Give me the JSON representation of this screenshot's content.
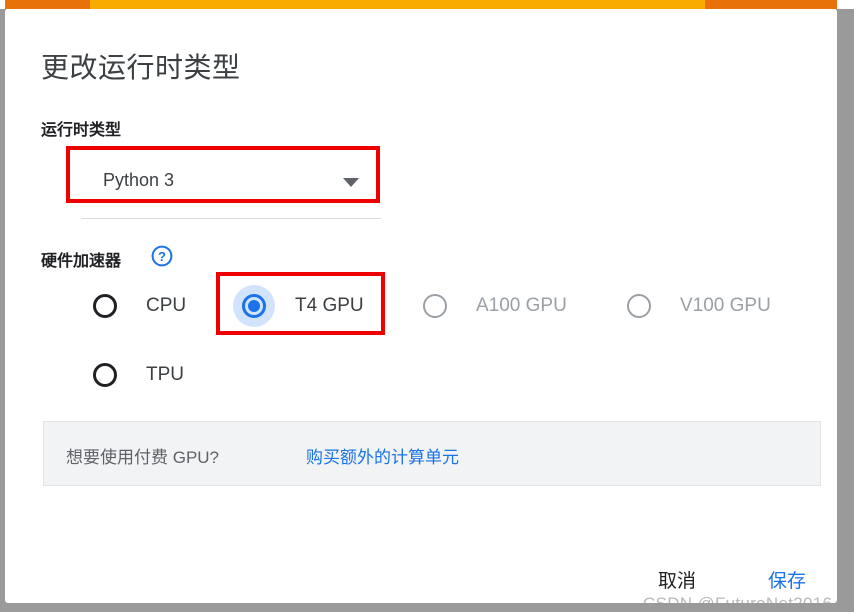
{
  "dialog": {
    "title": "更改运行时类型"
  },
  "progress": {
    "visible": true,
    "colors": {
      "primary": "#e8710a",
      "secondary": "#f9ab00"
    }
  },
  "runtime": {
    "label": "运行时类型",
    "selected": "Python 3",
    "dropdown_icon": "chevron-down-icon",
    "highlighted": true
  },
  "accelerator": {
    "label": "硬件加速器",
    "help_icon": "help-circle-icon",
    "options": [
      {
        "id": "cpu",
        "label": "CPU",
        "checked": false,
        "disabled": false,
        "highlighted": false
      },
      {
        "id": "t4",
        "label": "T4 GPU",
        "checked": true,
        "disabled": false,
        "highlighted": true
      },
      {
        "id": "a100",
        "label": "A100 GPU",
        "checked": false,
        "disabled": true,
        "highlighted": false
      },
      {
        "id": "v100",
        "label": "V100 GPU",
        "checked": false,
        "disabled": true,
        "highlighted": false
      },
      {
        "id": "tpu",
        "label": "TPU",
        "checked": false,
        "disabled": false,
        "highlighted": false
      }
    ]
  },
  "banner": {
    "text": "想要使用付费 GPU?",
    "link_label": "购买额外的计算单元"
  },
  "footer": {
    "cancel_label": "取消",
    "save_label": "保存"
  },
  "watermark": {
    "text": "CSDN @FutureNet2016"
  },
  "colors": {
    "accent": "#1a73e8",
    "annotation": "#ee0000",
    "banner_bg": "#f1f3f4",
    "disabled_text": "#9aa0a6"
  }
}
